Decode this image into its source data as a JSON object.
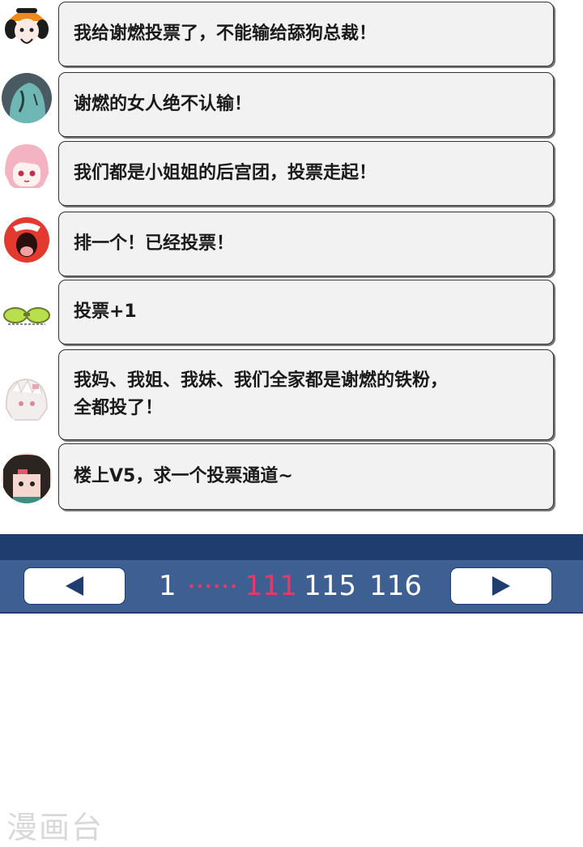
{
  "comments": [
    {
      "text": "我给谢燃投票了，不能输给舔狗总裁！"
    },
    {
      "text": "谢燃的女人绝不认输！"
    },
    {
      "text": "我们都是小姐姐的后宫团，投票走起！"
    },
    {
      "text": "排一个！已经投票！"
    },
    {
      "text": "投票+1"
    },
    {
      "text_line1": "我妈、我姐、我妹、我们全家都是谢燃的铁粉，",
      "text_line2": "全都投了！"
    },
    {
      "text": "楼上V5，求一个投票通道~"
    }
  ],
  "pagination": {
    "first": "1",
    "dots": "••••••",
    "current": "111",
    "page_a": "115",
    "page_b": "116",
    "prev_icon": "left-triangle-arrow",
    "next_icon": "right-triangle-arrow"
  },
  "watermark": "漫画台",
  "colors": {
    "bar": "#3d5f91",
    "bar_dark": "#1f3d6e",
    "highlight": "#e8386a"
  }
}
